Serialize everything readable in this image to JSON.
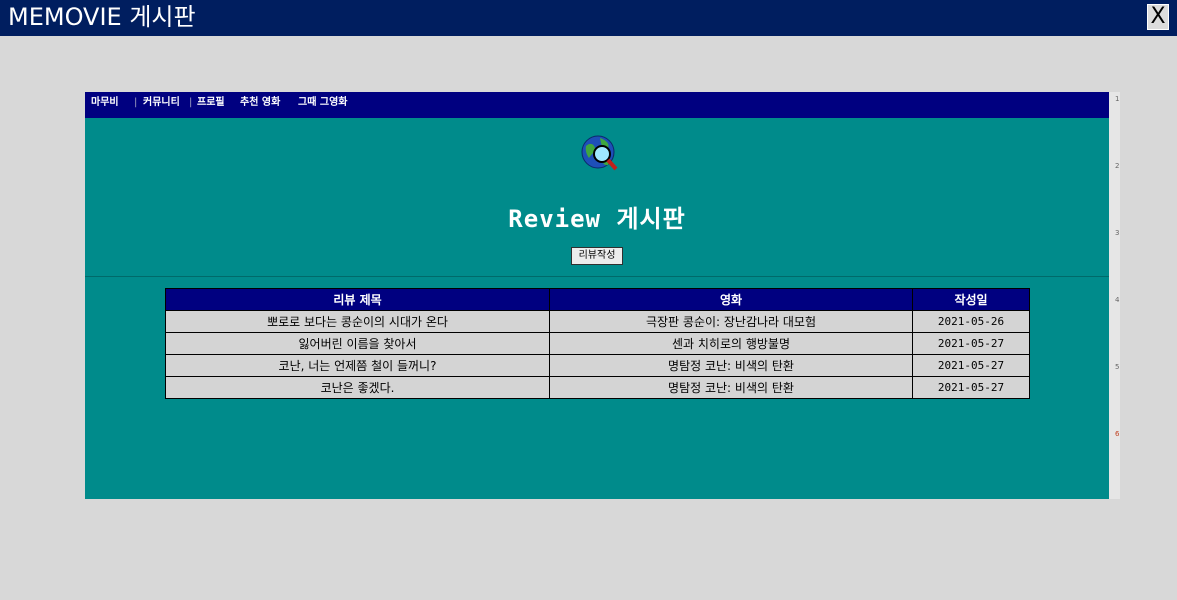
{
  "window": {
    "title": "MEMOVIE 게시판",
    "close_label": "X"
  },
  "nav": {
    "items": [
      "마무비",
      "커뮤니티",
      "프로필",
      "추천 영화",
      "그때 그영화"
    ]
  },
  "page": {
    "title": "Review 게시판",
    "write_button": "리뷰작성"
  },
  "table": {
    "headers": [
      "리뷰 제목",
      "영화",
      "작성일"
    ],
    "rows": [
      [
        "뽀로로 보다는 콩순이의 시대가 온다",
        "극장판 콩순이: 장난감나라 대모험",
        "2021-05-26"
      ],
      [
        "잃어버린 이름을 찾아서",
        "센과 치히로의 행방불명",
        "2021-05-27"
      ],
      [
        "코난, 너는 언제쯤 철이 들꺼니?",
        "명탐정 코난: 비색의 탄환",
        "2021-05-27"
      ],
      [
        "코난은 좋겠다.",
        "명탐정 코난: 비색의 탄환",
        "2021-05-27"
      ]
    ]
  },
  "ruler": {
    "marks": [
      "1",
      "2",
      "3",
      "4",
      "5",
      "6"
    ]
  },
  "colors": {
    "titlebar": "#001e5f",
    "nav": "#000080",
    "content": "#008b8b",
    "table_header": "#000080",
    "table_cell": "#d4d4d4"
  }
}
